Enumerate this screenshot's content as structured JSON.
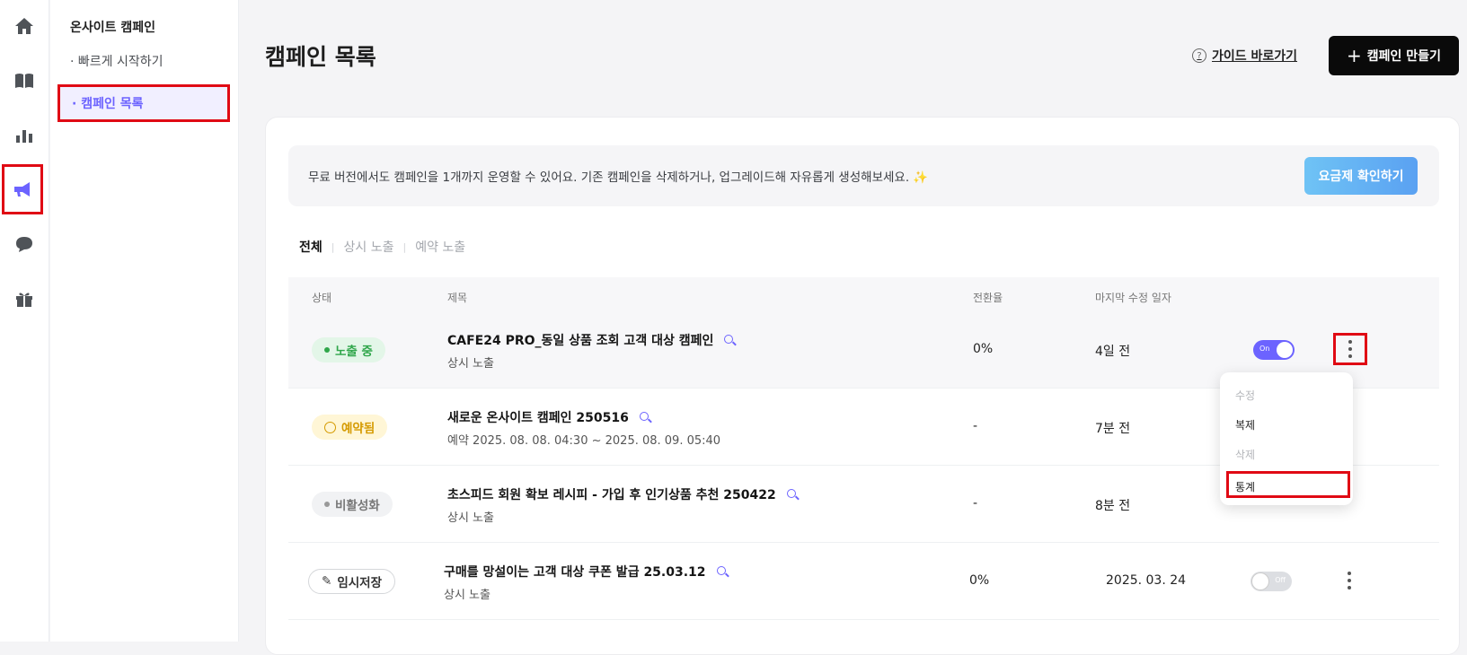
{
  "rail": {
    "icons": [
      "home-icon",
      "book-icon",
      "bar-chart-icon",
      "megaphone-icon",
      "chat-icon",
      "gift-icon"
    ]
  },
  "subnav": {
    "title": "온사이트 캠페인",
    "items": [
      {
        "label": "· 빠르게 시작하기"
      },
      {
        "label": "· 캠페인 목록"
      }
    ]
  },
  "header": {
    "title": "캠페인 목록",
    "guide_label": "가이드 바로가기",
    "guide_icon": "?",
    "create_label": "캠페인 만들기",
    "create_icon": "+"
  },
  "banner": {
    "text": "무료 버전에서도 캠페인을 1개까지 운영할 수 있어요. 기존 캠페인을 삭제하거나, 업그레이드해 자유롭게 생성해보세요. ✨",
    "button_label": "요금제 확인하기"
  },
  "filters": {
    "all": "전체",
    "always": "상시 노출",
    "reserved": "예약 노출"
  },
  "table": {
    "headers": {
      "status": "상태",
      "title": "제목",
      "rate": "전환율",
      "modified": "마지막 수정 일자"
    },
    "rows": [
      {
        "status": "노출 중",
        "title": "CAFE24 PRO_동일 상품 조회 고객 대상 캠페인",
        "sub": "상시 노출",
        "rate": "0%",
        "modified": "4일 전",
        "toggle": "On"
      },
      {
        "status": "예약됨",
        "title": "새로운 온사이트 캠페인 250516",
        "sub": "예약 2025. 08. 08. 04:30 ~ 2025. 08. 09. 05:40",
        "rate": "-",
        "modified": "7분 전",
        "toggle": ""
      },
      {
        "status": "비활성화",
        "title": "초스피드 회원 확보 레시피 - 가입 후 인기상품 추천 250422",
        "sub": "상시 노출",
        "rate": "-",
        "modified": "8분 전",
        "toggle": ""
      },
      {
        "status": "임시저장",
        "title": "구매를 망설이는 고객 대상 쿠폰 발급 25.03.12",
        "sub": "상시 노출",
        "rate": "0%",
        "modified": "2025. 03. 24",
        "toggle": "Off"
      }
    ]
  },
  "menu": {
    "edit": "수정",
    "copy": "복제",
    "delete": "삭제",
    "stats": "통계"
  }
}
